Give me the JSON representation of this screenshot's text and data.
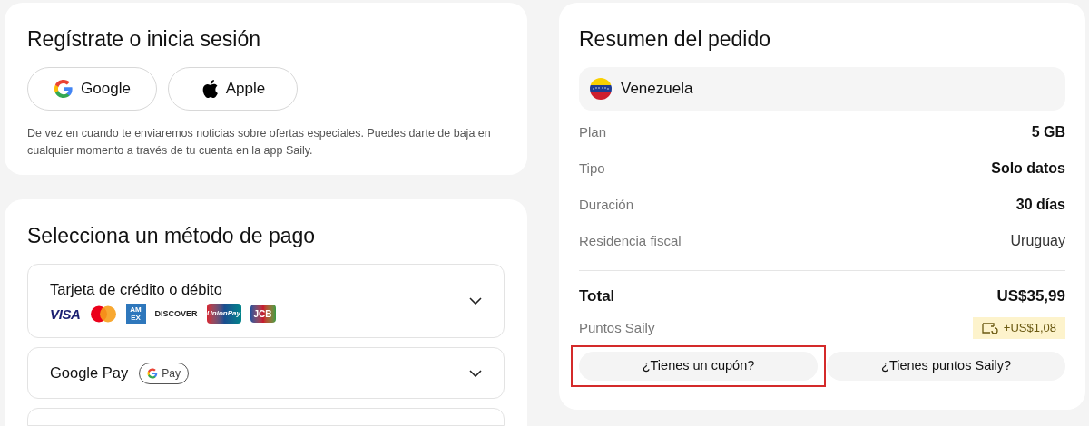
{
  "signin": {
    "title": "Regístrate o inicia sesión",
    "providers": [
      {
        "kind": "google",
        "label": "Google"
      },
      {
        "kind": "apple",
        "label": "Apple"
      }
    ],
    "notice": "De vez en cuando te enviaremos noticias sobre ofertas especiales. Puedes darte de baja en cualquier momento a través de tu cuenta en la app Saily."
  },
  "payment": {
    "title": "Selecciona un método de pago",
    "methods": [
      {
        "kind": "card",
        "label": "Tarjeta de crédito o débito",
        "expanded": false,
        "brands": [
          {
            "kind": "visa",
            "label": "VISA"
          },
          {
            "kind": "mastercard"
          },
          {
            "kind": "amex",
            "label": "AM EX"
          },
          {
            "kind": "discover",
            "label": "DISCOVER"
          },
          {
            "kind": "unionpay",
            "label": "UnionPay"
          },
          {
            "kind": "jcb",
            "label": "JCB"
          }
        ]
      },
      {
        "kind": "gpay",
        "label": "Google Pay",
        "badge": "Pay",
        "expanded": false
      }
    ]
  },
  "summary": {
    "title": "Resumen del pedido",
    "country": "Venezuela",
    "rows": [
      {
        "label": "Plan",
        "value": "5 GB"
      },
      {
        "label": "Tipo",
        "value": "Solo datos"
      },
      {
        "label": "Duración",
        "value": "30 días"
      },
      {
        "label": "Residencia fiscal",
        "value": "Uruguay",
        "link": true
      }
    ],
    "total": {
      "label": "Total",
      "value": "US$35,99"
    },
    "points": {
      "label": "Puntos Saily",
      "reward": "+US$1,08"
    },
    "buttons": [
      {
        "label": "¿Tienes un cupón?",
        "highlighted": true
      },
      {
        "label": "¿Tienes puntos Saily?",
        "highlighted": false
      }
    ]
  }
}
